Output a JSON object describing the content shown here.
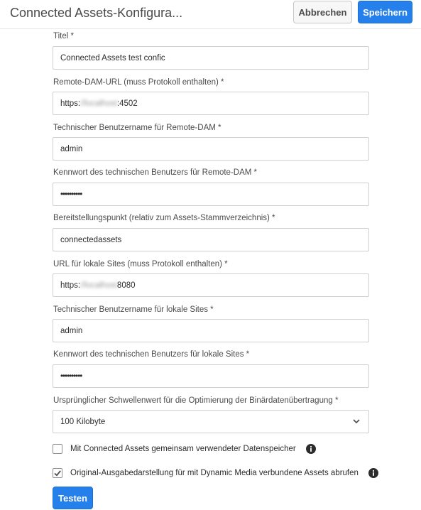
{
  "header": {
    "title": "Connected Assets-Konfigura...",
    "cancel_label": "Abbrechen",
    "save_label": "Speichern"
  },
  "fields": [
    {
      "label": "Titel *",
      "value": "Connected Assets test confic"
    },
    {
      "label": "Remote-DAM-URL (muss Protokoll enthalten) *",
      "value_prefix": "https:",
      "value_blurred": "//localhost",
      "value_suffix": ":4502"
    },
    {
      "label": "Technischer Benutzername für Remote-DAM *",
      "value": "admin"
    },
    {
      "label": "Kennwort des technischen Benutzers für Remote-DAM *",
      "value": "••••••••••"
    },
    {
      "label": "Bereitstellungspunkt (relativ zum Assets-Stammverzeichnis) *",
      "value": "connectedassets"
    },
    {
      "label": "URL für lokale Sites (muss Protokoll enthalten) *",
      "value_prefix": "https:",
      "value_blurred": "//localhost",
      "value_suffix": " 8080"
    },
    {
      "label": "Technischer Benutzername für lokale Sites *",
      "value": "admin"
    },
    {
      "label": "Kennwort des technischen Benutzers für lokale Sites *",
      "value": "••••••••••"
    },
    {
      "label": "Ursprünglicher Schwellenwert für die Optimierung der Binärdatenübertragung *",
      "value": "100 Kilobyte"
    }
  ],
  "checkboxes": [
    {
      "label": "Mit Connected Assets gemeinsam verwendeter Datenspeicher",
      "checked": false
    },
    {
      "label": "Original-Ausgabedarstellung für mit Dynamic Media verbundene Assets abrufen",
      "checked": true
    }
  ],
  "test_label": "Testen",
  "colors": {
    "accent": "#2680eb",
    "border": "#d0d0d0"
  },
  "icons": {
    "info": "info-icon",
    "chevron": "chevron-down-icon",
    "check": "checkmark-icon"
  }
}
